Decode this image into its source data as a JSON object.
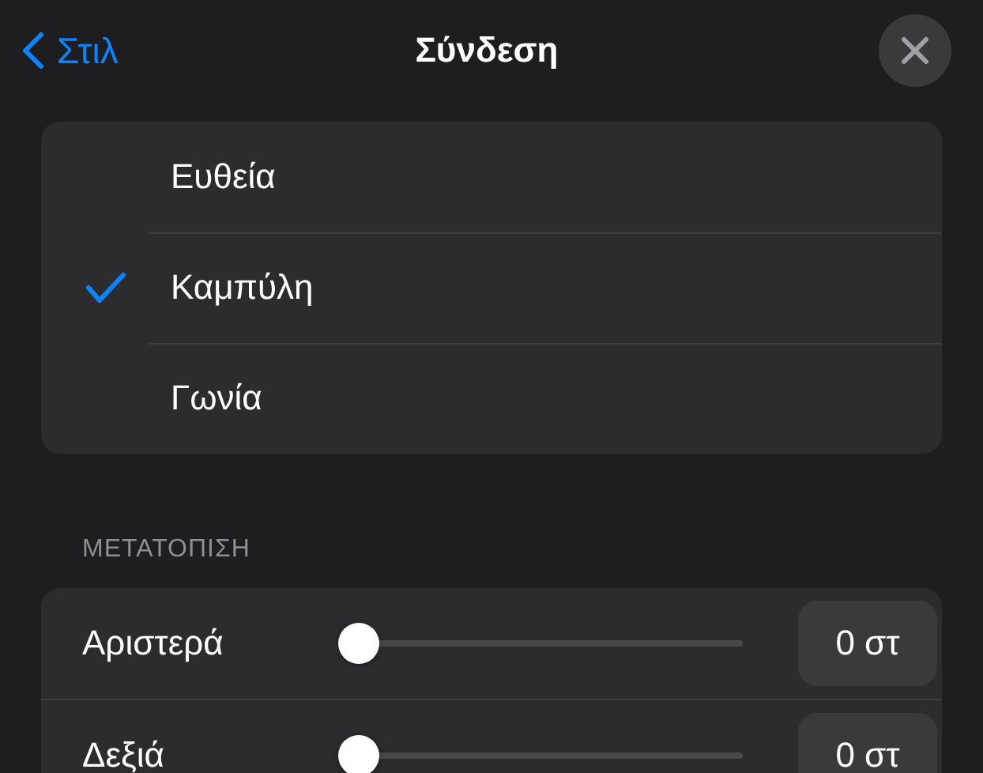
{
  "header": {
    "back_label": "Στιλ",
    "title": "Σύνδεση"
  },
  "connection_types": [
    {
      "label": "Ευθεία",
      "selected": false
    },
    {
      "label": "Καμπύλη",
      "selected": true
    },
    {
      "label": "Γωνία",
      "selected": false
    }
  ],
  "offset": {
    "heading": "ΜΕΤΑΤΟΠΙΣΗ",
    "rows": [
      {
        "label": "Αριστερά",
        "level": 0,
        "value": "0 στ"
      },
      {
        "label": "Δεξιά",
        "level": 0,
        "value": "0 στ"
      }
    ]
  }
}
